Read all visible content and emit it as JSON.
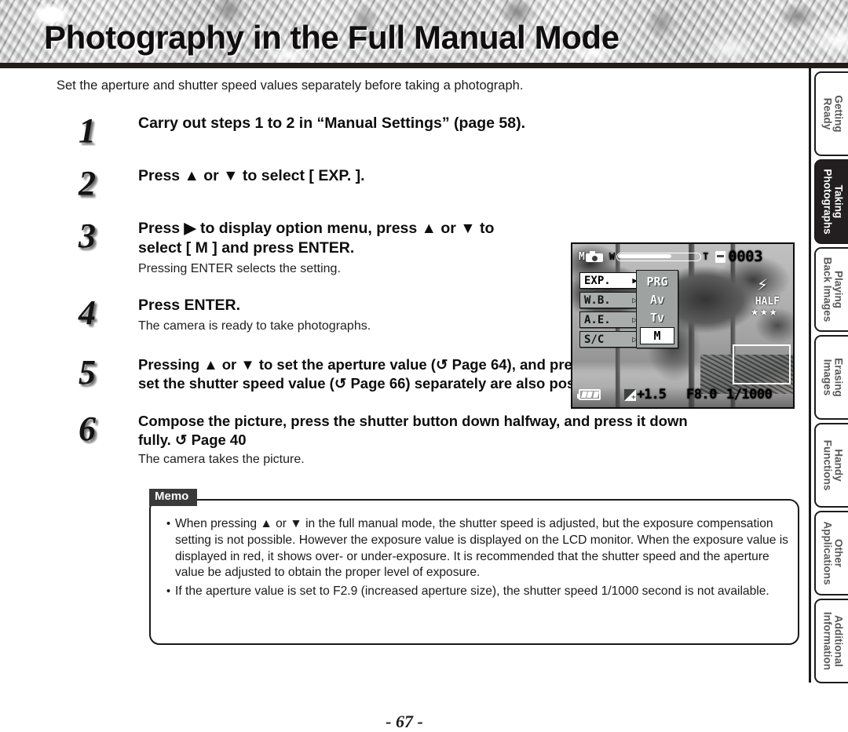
{
  "header": {
    "title": "Photography in the Full Manual Mode"
  },
  "intro": "Set the aperture and shutter speed values separately before taking a photograph.",
  "steps": [
    {
      "num": "1",
      "head": "Carry out steps 1 to 2 in “Manual Settings” (page 58).",
      "sub": ""
    },
    {
      "num": "2",
      "head_pre": "Press ",
      "head_post": " to select [ EXP. ].",
      "head": "Press ▲ or ▼ to select [ EXP. ].",
      "sub": ""
    },
    {
      "num": "3",
      "head_line1": "Press ▶ to display option menu, press ▲ or ▼ to",
      "head_line2": "select  [ M ] and press ENTER.",
      "sub": "Pressing ENTER selects the setting."
    },
    {
      "num": "4",
      "head": "Press ENTER.",
      "sub": "The camera is ready to take photographs."
    },
    {
      "num": "5",
      "head_line1": "Pressing ▲ or ▼ to set the aperture value (↺ Page 64),  and pressing ▲ or ▼ to",
      "head_line2": "set the shutter speed value (↺ Page 66) separately are also possible.",
      "sub": ""
    },
    {
      "num": "6",
      "head_line1": "Compose the picture, press the shutter button down halfway, and press it down",
      "head_line2": "fully. ↺ Page 40",
      "sub": "The camera takes the picture."
    }
  ],
  "lcd": {
    "mode": "M",
    "camera_icon": "camera-icon",
    "zoom_wide_label": "W",
    "zoom_tele_label": "T",
    "card_icon": "memory-card-icon",
    "frame_count": "0003",
    "menu_items": [
      {
        "label": "EXP.",
        "arrow": "▶",
        "selected": true
      },
      {
        "label": "W.B.",
        "arrow": "▷",
        "selected": false
      },
      {
        "label": "A.E.",
        "arrow": "▷",
        "selected": false
      },
      {
        "label": "S/C",
        "arrow": "▷",
        "selected": false
      }
    ],
    "options": [
      {
        "label": "PRG",
        "selected": false
      },
      {
        "label": "Av",
        "selected": false
      },
      {
        "label": "Tv",
        "selected": false
      },
      {
        "label": "M",
        "selected": true
      }
    ],
    "flash_icon": "⚡",
    "half_label": "HALF",
    "stars": "★★★",
    "battery_icon": "battery-icon",
    "ev_icon": "exposure-compensation-icon",
    "ev_value": "+1.5",
    "aperture": "F8.0",
    "shutter_speed": "1/1000"
  },
  "memo": {
    "label": "Memo",
    "items": [
      {
        "bullet": "•",
        "text": "When pressing ▲ or ▼ in the full manual mode, the shutter speed is adjusted, but the exposure compensation setting is not possible. However the exposure value is displayed on the LCD monitor. When the exposure value is displayed in red, it shows over- or under-exposure. It is recommended that the shutter speed and the aperture value be adjusted to obtain the proper level of exposure."
      },
      {
        "bullet": "•",
        "text": "If the aperture value is set to F2.9 (increased aperture size), the shutter speed 1/1000 second is not available."
      }
    ]
  },
  "footer": {
    "page_number": "- 67 -"
  },
  "tabs": [
    {
      "line1": "Getting",
      "line2": "Ready",
      "active": false
    },
    {
      "line1": "Taking",
      "line2": "Photographs",
      "active": true
    },
    {
      "line1": "Playing",
      "line2": "Back Images",
      "active": false
    },
    {
      "line1": "Erasing",
      "line2": "Images",
      "active": false
    },
    {
      "line1": "Handy",
      "line2": "Functions",
      "active": false
    },
    {
      "line1": "Other",
      "line2": "Applications",
      "active": false
    },
    {
      "line1": "Additional",
      "line2": "Information",
      "active": false
    }
  ]
}
